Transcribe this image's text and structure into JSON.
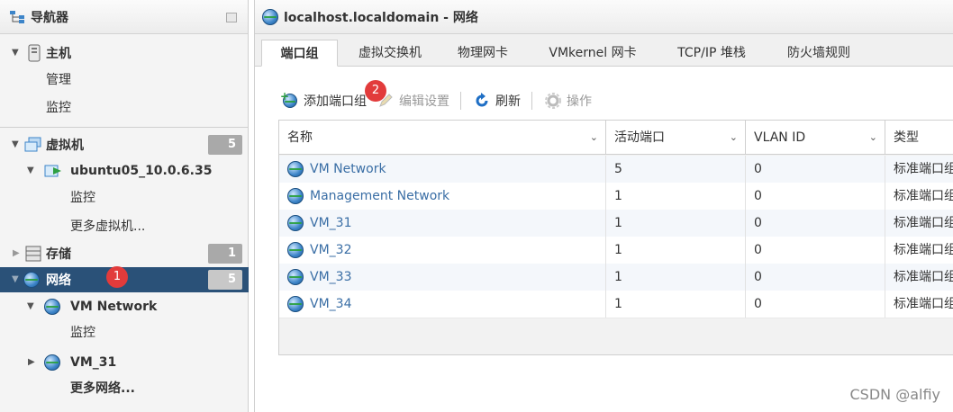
{
  "navigator": {
    "title": "导航器",
    "host": {
      "label": "主机",
      "children": [
        "管理",
        "监控"
      ]
    },
    "vms": {
      "label": "虚拟机",
      "badge": "5",
      "vm_label": "ubuntu05_10.0.6.35",
      "vm_children": [
        "监控",
        "更多虚拟机..."
      ]
    },
    "storage": {
      "label": "存储",
      "badge": "1"
    },
    "network": {
      "label": "网络",
      "badge": "5",
      "sub1": "VM Network",
      "sub1_child": "监控",
      "sub2": "VM_31",
      "more": "更多网络..."
    },
    "marker": "1"
  },
  "main": {
    "title": "localhost.localdomain - 网络",
    "tabs": [
      "端口组",
      "虚拟交换机",
      "物理网卡",
      "VMkernel 网卡",
      "TCP/IP 堆栈",
      "防火墙规则"
    ],
    "toolbar": {
      "add": "添加端口组",
      "edit": "编辑设置",
      "refresh": "刷新",
      "actions": "操作",
      "marker": "2"
    },
    "table": {
      "columns": [
        "名称",
        "活动端口",
        "VLAN ID",
        "类型"
      ],
      "rows": [
        {
          "name": "VM Network",
          "ports": "5",
          "vlan": "0",
          "type": "标准端口组"
        },
        {
          "name": "Management Network",
          "ports": "1",
          "vlan": "0",
          "type": "标准端口组"
        },
        {
          "name": "VM_31",
          "ports": "1",
          "vlan": "0",
          "type": "标准端口组"
        },
        {
          "name": "VM_32",
          "ports": "1",
          "vlan": "0",
          "type": "标准端口组"
        },
        {
          "name": "VM_33",
          "ports": "1",
          "vlan": "0",
          "type": "标准端口组"
        },
        {
          "name": "VM_34",
          "ports": "1",
          "vlan": "0",
          "type": "标准端口组"
        }
      ]
    }
  },
  "watermark": "CSDN @alfiy"
}
